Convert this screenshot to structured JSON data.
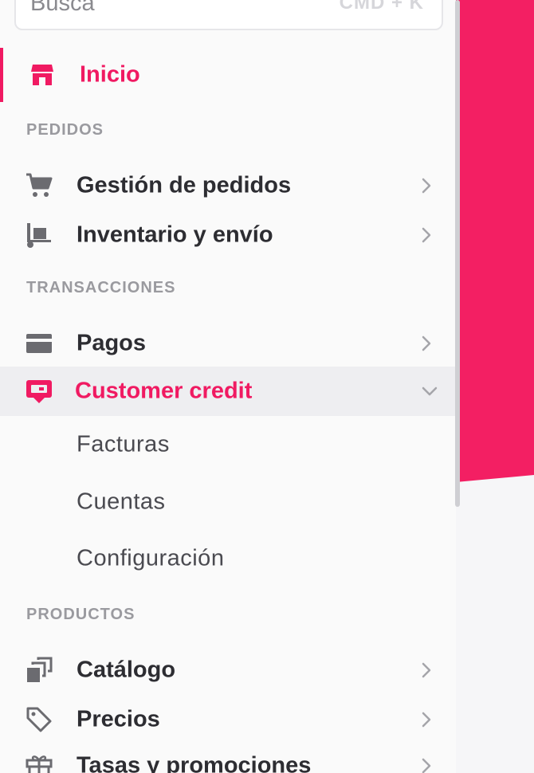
{
  "search": {
    "placeholder": "Busca",
    "shortcut": "CMD + K"
  },
  "nav": {
    "home": {
      "label": "Inicio",
      "icon": "store-icon"
    },
    "sections": [
      {
        "title": "PEDIDOS",
        "items": [
          {
            "label": "Gestión de pedidos",
            "icon": "cart-icon"
          },
          {
            "label": "Inventario y envío",
            "icon": "hand-truck-icon"
          }
        ]
      },
      {
        "title": "TRANSACCIONES",
        "items": [
          {
            "label": "Pagos",
            "icon": "credit-card-icon"
          },
          {
            "label": "Customer credit",
            "icon": "customer-credit-icon",
            "expanded": true,
            "subitems": [
              "Facturas",
              "Cuentas",
              "Configuración"
            ]
          }
        ]
      },
      {
        "title": "PRODUCTOS",
        "items": [
          {
            "label": "Catálogo",
            "icon": "catalog-icon"
          },
          {
            "label": "Precios",
            "icon": "price-tag-icon"
          },
          {
            "label": "Tasas y promociones",
            "icon": "gift-icon"
          }
        ]
      }
    ]
  },
  "colors": {
    "accent": "#f01a62",
    "text": "#2d2d32",
    "section": "#9a9a9f",
    "icon": "#6b6b70",
    "expanded_bg": "#eeeef1"
  }
}
